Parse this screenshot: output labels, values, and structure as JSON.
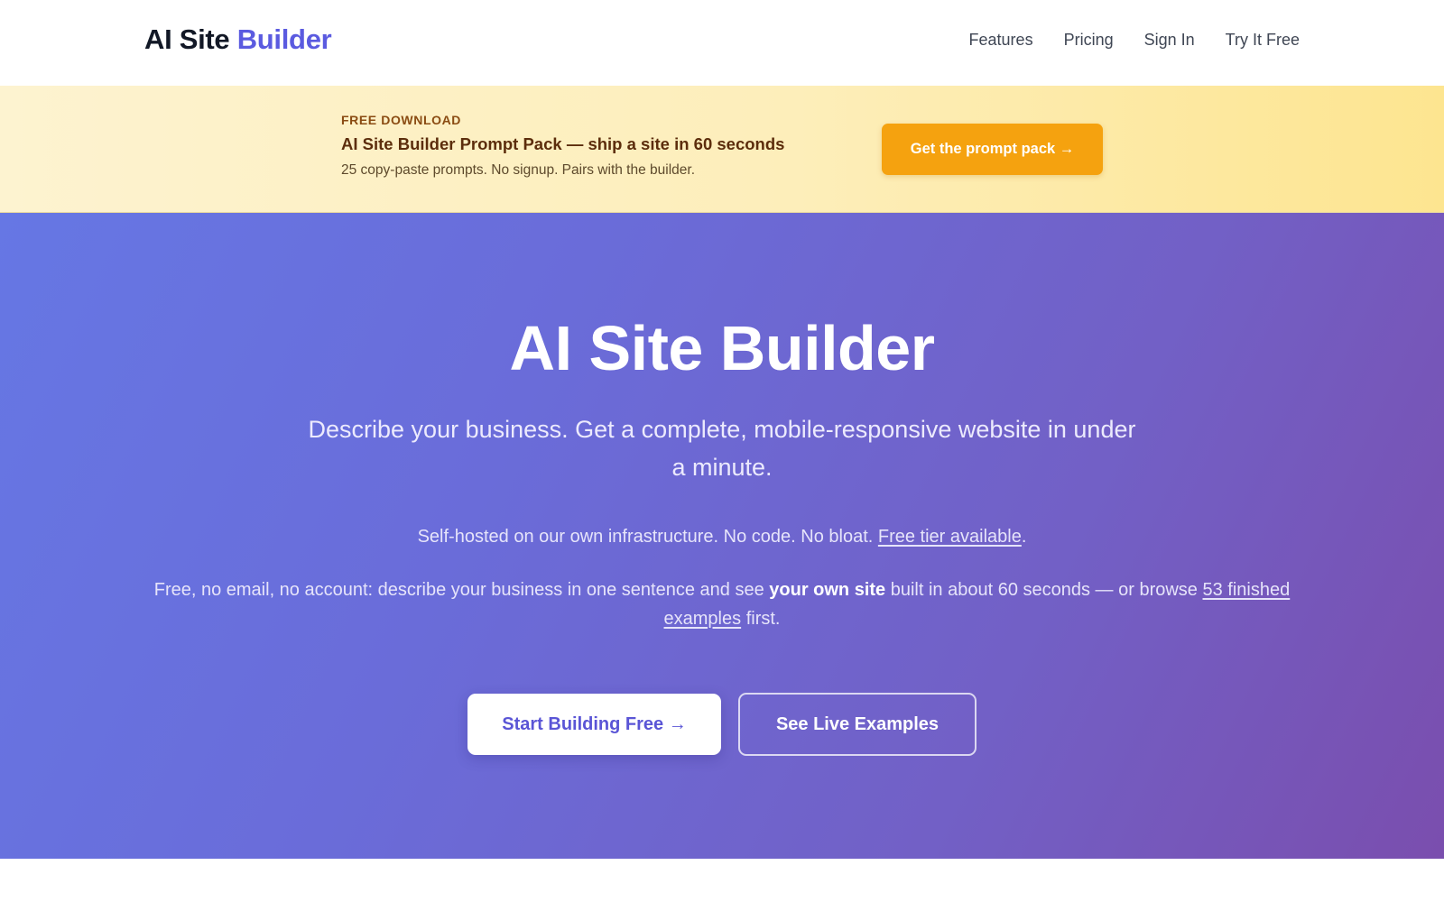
{
  "header": {
    "logo_primary": "AI Site",
    "logo_accent": "Builder",
    "nav": [
      {
        "label": "Features"
      },
      {
        "label": "Pricing"
      },
      {
        "label": "Sign In"
      },
      {
        "label": "Try It Free"
      }
    ]
  },
  "promo": {
    "kicker": "FREE DOWNLOAD",
    "title": "AI Site Builder Prompt Pack — ship a site in 60 seconds",
    "subtitle": "25 copy-paste prompts. No signup. Pairs with the builder.",
    "button_label": "Get the prompt pack →",
    "button_color": "#f5a20f"
  },
  "hero": {
    "title": "AI Site Builder",
    "subtitle": "Describe your business. Get a complete, mobile-responsive website in under a minute.",
    "note_text": "Self-hosted on our own infrastructure. No code. No bloat.",
    "note_link": "Free tier available",
    "note_end": ".",
    "cta_text_1": "Free, no email, no account: describe your business in one sentence and see",
    "cta_strong": "your own site",
    "cta_text_2": "built in about 60 seconds — or browse",
    "cta_link": "53 finished examples",
    "cta_text_3": "first.",
    "primary_button": "Start Building Free →",
    "secondary_button": "See Live Examples",
    "gradient_start": "#6677e4",
    "gradient_end": "#7a4eae",
    "accent": "#5b5be0"
  }
}
